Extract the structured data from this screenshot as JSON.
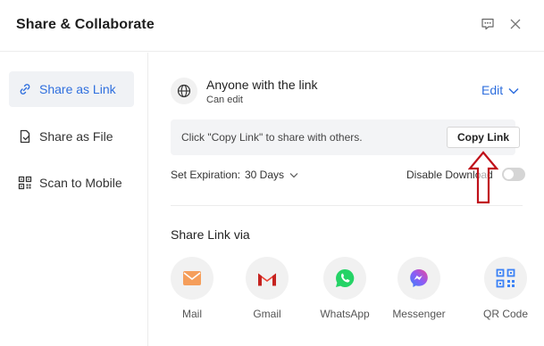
{
  "dialog": {
    "title": "Share & Collaborate",
    "feedback_icon": "feedback-icon",
    "close_icon": "close-icon"
  },
  "sidebar": {
    "items": [
      {
        "label": "Share as Link",
        "icon": "link-icon",
        "active": true
      },
      {
        "label": "Share as File",
        "icon": "file-icon",
        "active": false
      },
      {
        "label": "Scan to Mobile",
        "icon": "qr-icon",
        "active": false
      }
    ]
  },
  "access": {
    "title": "Anyone with the link",
    "permission": "Can edit",
    "edit_label": "Edit"
  },
  "link": {
    "hint": "Click \"Copy Link\" to share with others.",
    "copy_button": "Copy Link"
  },
  "settings": {
    "expiration_label": "Set Expiration:",
    "expiration_value": "30 Days",
    "disable_download_label": "Disable Download",
    "disable_download_on": false
  },
  "share_via": {
    "title": "Share Link via",
    "apps": [
      {
        "label": "Mail",
        "icon": "mail-icon",
        "color": "#f59e5b"
      },
      {
        "label": "Gmail",
        "icon": "gmail-icon",
        "color": "#ea4335"
      },
      {
        "label": "WhatsApp",
        "icon": "whatsapp-icon",
        "color": "#25d366"
      },
      {
        "label": "Messenger",
        "icon": "messenger-icon",
        "color": "#8b5cf6"
      },
      {
        "label": "QR Code",
        "icon": "qr-code-icon",
        "color": "#3b82f6"
      }
    ]
  },
  "colors": {
    "accent": "#2f6fde",
    "annotation_arrow": "#c0111a"
  }
}
